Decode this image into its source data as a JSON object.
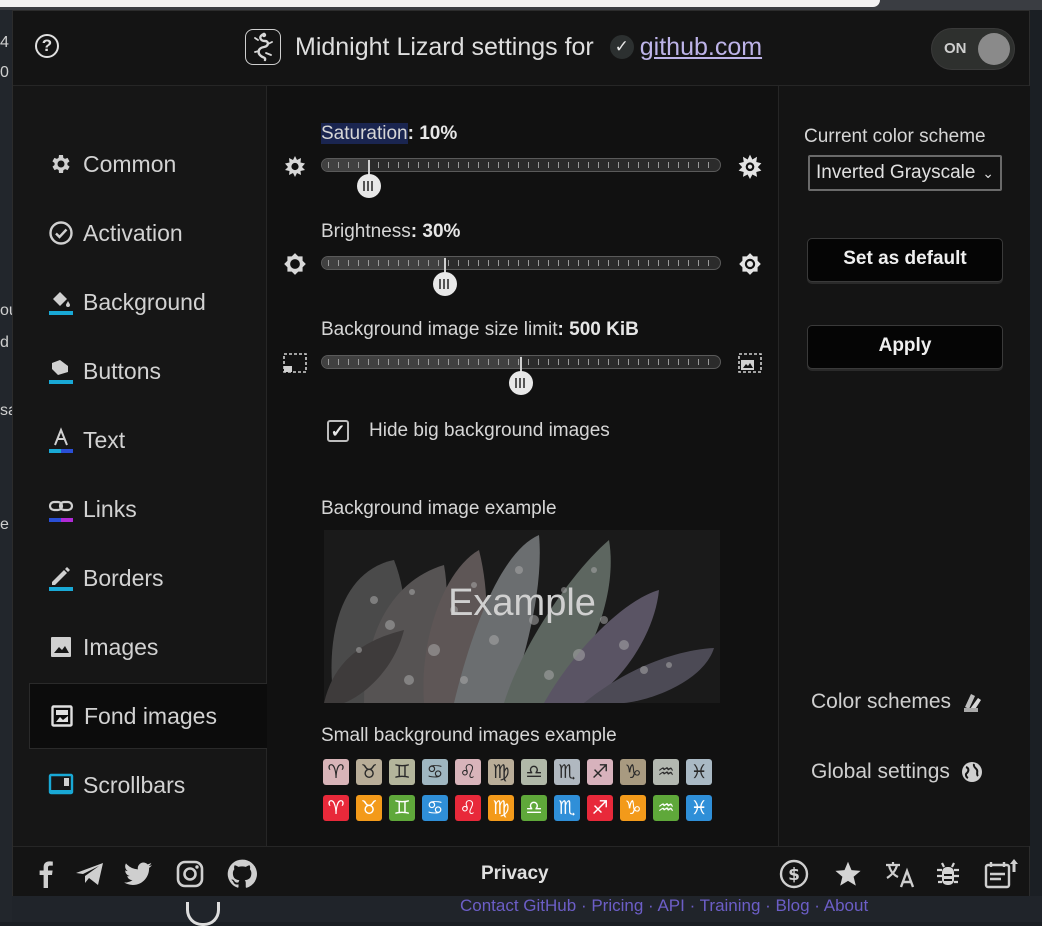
{
  "header": {
    "title": "Midnight Lizard settings for",
    "site": "github.com",
    "check_glyph": "✓",
    "help_glyph": "?",
    "toggle_label": "ON",
    "toggle_state": "on"
  },
  "background_page": {
    "left_fragments": [
      "4",
      "0",
      "ou",
      "d",
      "sa",
      "e"
    ],
    "footer_links": "Contact GitHub · Pricing · API · Training · Blog · About"
  },
  "sidebar": {
    "items": [
      {
        "label": "Common",
        "icon": "gear-icon",
        "active": false
      },
      {
        "label": "Activation",
        "icon": "check-circle-icon",
        "active": false
      },
      {
        "label": "Background",
        "icon": "paint-bucket-icon",
        "active": false
      },
      {
        "label": "Buttons",
        "icon": "button-press-icon",
        "active": false
      },
      {
        "label": "Text",
        "icon": "text-a-icon",
        "active": false
      },
      {
        "label": "Links",
        "icon": "link-icon",
        "active": false
      },
      {
        "label": "Borders",
        "icon": "pencil-icon",
        "active": false
      },
      {
        "label": "Images",
        "icon": "image-icon",
        "active": false
      },
      {
        "label": "Fond images",
        "icon": "wallpaper-icon",
        "active": true
      },
      {
        "label": "Scrollbars",
        "icon": "scrollbar-icon",
        "active": false
      }
    ]
  },
  "main": {
    "saturation": {
      "label": "Saturation",
      "value_text": "10%",
      "value": 0.1
    },
    "brightness": {
      "label": "Brightness",
      "value_text": "30%",
      "value": 0.3
    },
    "size_limit": {
      "label": "Background image size limit",
      "value_text": "500 KiB",
      "value": 0.5
    },
    "hide_big": {
      "label": "Hide big background images",
      "checked": true,
      "glyph": "✓"
    },
    "bg_example_label": "Background image example",
    "bg_example_text": "Example",
    "small_example_label": "Small background images example",
    "zodiac_glyphs": [
      "♈",
      "♉",
      "♊",
      "♋",
      "♌",
      "♍",
      "♎",
      "♏",
      "♐",
      "♑",
      "♒",
      "♓"
    ],
    "zodiac_muted_bg": [
      "#d8b4b8",
      "#b8ad98",
      "#b3b59b",
      "#9fb6c0",
      "#d8b4ba",
      "#b9ad98",
      "#b0b8a8",
      "#b0b8c0",
      "#d7b2bc",
      "#a89a80",
      "#b3b8b0",
      "#a9b9c4"
    ],
    "zodiac_bright_bg": [
      "#e8293a",
      "#f39a1a",
      "#5fa83a",
      "#2f8fd8",
      "#e8293a",
      "#f39a1a",
      "#5fa83a",
      "#2f8fd8",
      "#e8293a",
      "#f39a1a",
      "#5fa83a",
      "#2f8fd8"
    ],
    "accent_cyan": "#19a9d6"
  },
  "right": {
    "scheme_label": "Current color scheme",
    "scheme_value": "Inverted Grayscale",
    "set_default": "Set as default",
    "apply": "Apply",
    "color_schemes": "Color schemes",
    "global_settings": "Global settings"
  },
  "footer": {
    "privacy": "Privacy",
    "icons": [
      "facebook-icon",
      "telegram-icon",
      "twitter-icon",
      "instagram-icon",
      "github-icon",
      "donate-icon",
      "star-icon",
      "translate-icon",
      "bug-icon",
      "changelog-icon"
    ]
  }
}
